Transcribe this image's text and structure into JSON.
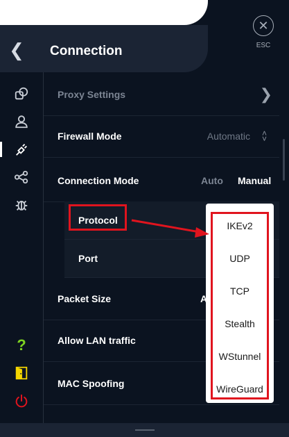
{
  "header": {
    "title": "Connection",
    "back_icon": "chevron-left-icon",
    "esc_label": "ESC",
    "esc_icon": "close-icon"
  },
  "sidebar": {
    "items": [
      {
        "name": "sidebar-item-general",
        "icon": "general-icon"
      },
      {
        "name": "sidebar-item-account",
        "icon": "user-icon"
      },
      {
        "name": "sidebar-item-connection",
        "icon": "plug-icon",
        "active": true
      },
      {
        "name": "sidebar-item-share",
        "icon": "share-icon"
      },
      {
        "name": "sidebar-item-debug",
        "icon": "bug-icon"
      }
    ],
    "bottom_items": [
      {
        "name": "help-button",
        "icon": "question-icon",
        "color": "#7ed321"
      },
      {
        "name": "sidebar-item-door",
        "icon": "door-icon",
        "color": "#f5d600"
      },
      {
        "name": "power-button",
        "icon": "power-icon",
        "color": "#e0141e"
      }
    ]
  },
  "settings": {
    "proxy_label": "Proxy Settings",
    "firewall_label": "Firewall Mode",
    "firewall_value": "Automatic",
    "connection_mode_label": "Connection Mode",
    "mode_auto": "Auto",
    "mode_manual": "Manual",
    "protocol_label": "Protocol",
    "port_label": "Port",
    "packet_size_label": "Packet Size",
    "packet_size_value": "A",
    "allow_lan_label": "Allow LAN traffic",
    "mac_spoofing_label": "MAC Spoofing"
  },
  "dropdown": {
    "options": [
      "IKEv2",
      "UDP",
      "TCP",
      "Stealth",
      "WStunnel",
      "WireGuard"
    ]
  },
  "colors": {
    "background": "#0b1320",
    "header": "#1b2434",
    "annotation": "#e0141e"
  }
}
